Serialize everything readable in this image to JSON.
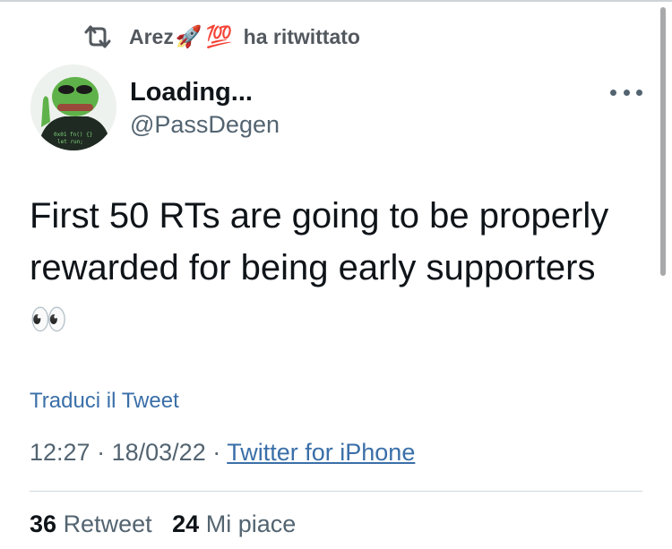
{
  "retweet": {
    "user": "Arez",
    "emojis": [
      "🚀",
      "💯"
    ],
    "action": "ha ritwittato"
  },
  "author": {
    "name": "Loading...",
    "handle": "@PassDegen"
  },
  "tweet": {
    "line1": "First 50 RTs are going to be properly",
    "line2": "rewarded for being early supporters",
    "emoji": "👀"
  },
  "translate_label": "Traduci il Tweet",
  "meta": {
    "time": "12:27",
    "separator": "·",
    "date": "18/03/22",
    "source": "Twitter for iPhone"
  },
  "stats": {
    "retweets_count": "36",
    "retweets_label": "Retweet",
    "likes_count": "24",
    "likes_label": "Mi piace"
  },
  "colors": {
    "link": "#3a6fa8",
    "secondary": "#536471",
    "avatar_green": "#5fb24a"
  },
  "icons": [
    "retweet-icon",
    "more-options-icon"
  ]
}
